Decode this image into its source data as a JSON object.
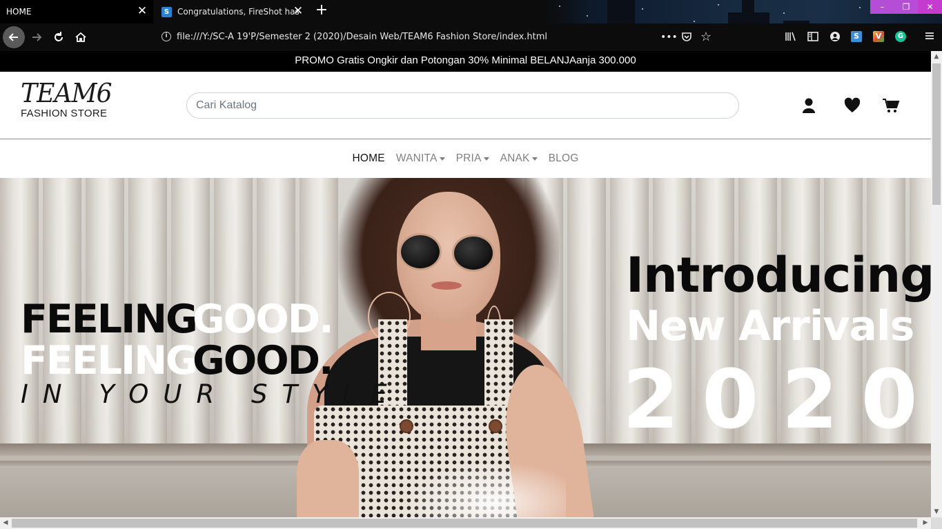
{
  "browser": {
    "tabs": [
      {
        "title": "HOME",
        "active": true
      },
      {
        "title": "Congratulations, FireShot has b",
        "active": false,
        "favicon": "S"
      }
    ],
    "new_tab_label": "+",
    "url": "file:///Y:/SC-A 19'P/Semester 2 (2020)/Desain Web/TEAM6 Fashion Store/index.html",
    "window_controls": [
      "–",
      "❐",
      "✕"
    ],
    "toolbar_icons": [
      "more-icon",
      "pocket-icon",
      "star-icon",
      "library-icon",
      "sidebar-icon",
      "account-icon",
      "fireshot-icon",
      "extension-v-icon",
      "grammarly-icon",
      "menu-icon"
    ]
  },
  "promo": {
    "text": "PROMO Gratis Ongkir dan Potongan 30% Minimal BELANJAanja 300.000"
  },
  "header": {
    "logo_main": "TEAM6",
    "logo_sub": "FASHION STORE",
    "search_placeholder": "Cari Katalog",
    "icons": [
      "user-icon",
      "heart-icon",
      "cart-icon"
    ]
  },
  "menu": {
    "items": [
      {
        "label": "HOME",
        "active": true,
        "dropdown": false
      },
      {
        "label": "WANITA",
        "active": false,
        "dropdown": true
      },
      {
        "label": "PRIA",
        "active": false,
        "dropdown": true
      },
      {
        "label": "ANAK",
        "active": false,
        "dropdown": true
      },
      {
        "label": "BLOG",
        "active": false,
        "dropdown": false
      }
    ]
  },
  "hero": {
    "line1_black": "FEELING",
    "line1_white": "GOOD.",
    "line2_white": "FEELING",
    "line2_black": "GOOD.",
    "line3": "IN YOUR STYLE",
    "right_line1": "Introducing",
    "right_line2": "New Arrivals",
    "right_line3": "2 0 2 0"
  },
  "colors": {
    "promo_bg": "#000000",
    "menu_active": "#111111",
    "menu_inactive": "#7f7f7f",
    "headline_dark": "#0a0a0a",
    "headline_light": "#ffffff"
  }
}
